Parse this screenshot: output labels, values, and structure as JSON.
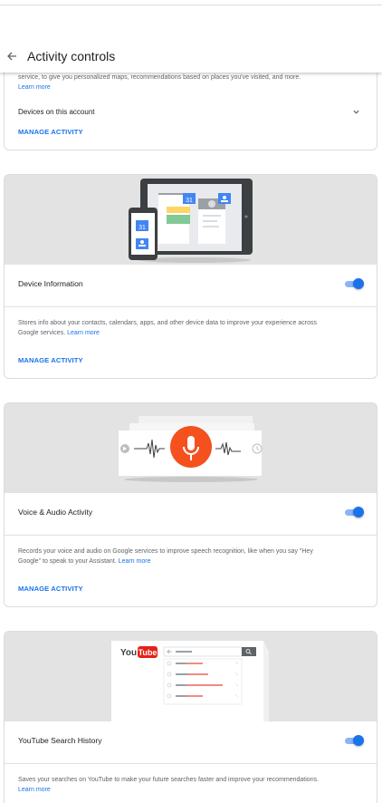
{
  "app_bar": {
    "title": "Activity controls"
  },
  "location_card": {
    "description": "service, to give you personalized maps, recommendations based on places you've visited, and more.",
    "learn_more": "Learn more",
    "devices_label": "Devices on this account",
    "manage": "MANAGE ACTIVITY"
  },
  "device_card": {
    "title": "Device Information",
    "toggle_on": true,
    "description": "Stores info about your contacts, calendars, apps, and other device data to improve your experience across Google services.",
    "learn_more": "Learn more",
    "manage": "MANAGE ACTIVITY",
    "calendar_day": "31"
  },
  "voice_card": {
    "title": "Voice & Audio Activity",
    "toggle_on": true,
    "description": "Records your voice and audio on Google services to improve speech recognition, like when you say \"Hey Google\" to speak to your Assistant.",
    "learn_more": "Learn more",
    "manage": "MANAGE ACTIVITY"
  },
  "youtube_card": {
    "title": "YouTube Search History",
    "toggle_on": true,
    "description": "Saves your searches on YouTube to make your future searches faster and improve your recommendations.",
    "learn_more": "Learn more",
    "logo_you": "You",
    "logo_tube": "Tube"
  },
  "colors": {
    "accent": "#1a73e8",
    "toggle_track": "#8ab4f8",
    "hero_bg": "#e3e3e3",
    "mic_red": "#f4511e",
    "youtube_red": "#e62117"
  }
}
